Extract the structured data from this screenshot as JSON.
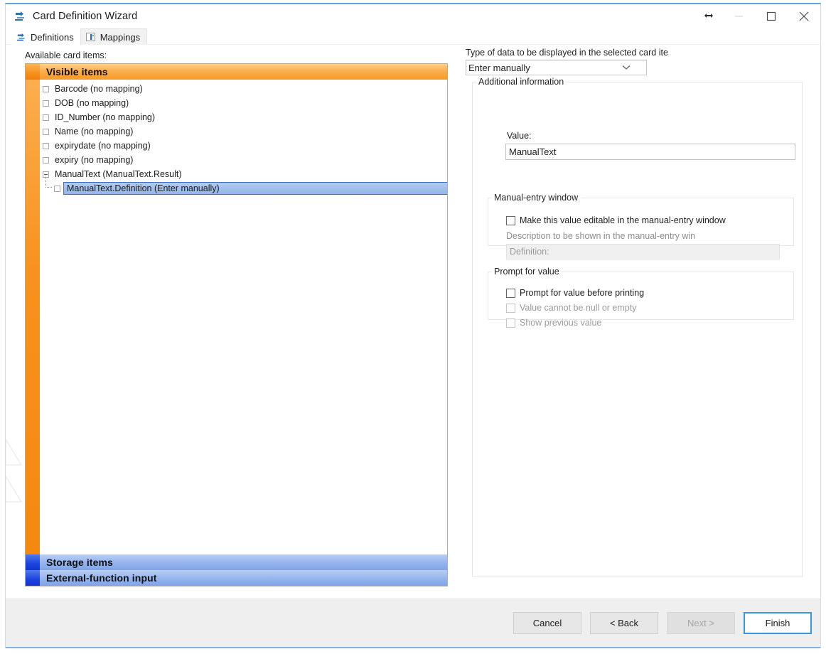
{
  "window": {
    "title": "Card Definition Wizard",
    "icon": "wizard-arrow-icon",
    "controls": {
      "minimize": "—",
      "maximize": "□",
      "close": "✕"
    }
  },
  "tabs": [
    {
      "label": "Definitions",
      "icon": "wizard-arrow-icon",
      "active": false
    },
    {
      "label": "Mappings",
      "icon": "mappings-icon",
      "active": true
    }
  ],
  "left": {
    "label": "Available card items:",
    "groups": [
      {
        "name": "Visible items",
        "color": "#f7921e",
        "accent": "#f79a26"
      },
      {
        "name": "Storage items",
        "color": "#1b42e0",
        "accent": "#9ab8ee"
      },
      {
        "name": "External-function input",
        "color": "#1b42e0",
        "accent": "#9ab8ee"
      }
    ],
    "tree": [
      {
        "label": "Barcode (no mapping)",
        "indent": 0,
        "selected": false,
        "expander": "box"
      },
      {
        "label": "DOB (no mapping)",
        "indent": 0,
        "selected": false,
        "expander": "box"
      },
      {
        "label": "ID_Number (no mapping)",
        "indent": 0,
        "selected": false,
        "expander": "box"
      },
      {
        "label": "Name (no mapping)",
        "indent": 0,
        "selected": false,
        "expander": "box"
      },
      {
        "label": "expirydate (no mapping)",
        "indent": 0,
        "selected": false,
        "expander": "box"
      },
      {
        "label": "expiry (no mapping)",
        "indent": 0,
        "selected": false,
        "expander": "box"
      },
      {
        "label": "ManualText (ManualText.Result)",
        "indent": 0,
        "selected": false,
        "expander": "minus"
      },
      {
        "label": "ManualText.Definition (Enter manually)",
        "indent": 1,
        "selected": true,
        "expander": "box"
      }
    ]
  },
  "right": {
    "type_label": "Type of data to be displayed in the selected card ite",
    "type_value": "Enter manually",
    "additional_legend": "Additional information",
    "value_label": "Value:",
    "value_text": "ManualText",
    "manual_entry": {
      "legend": "Manual-entry window",
      "editable_checkbox": "Make this value editable in the manual-entry window",
      "description_label": "Description to be shown in the manual-entry win",
      "description_value": "Definition:"
    },
    "prompt": {
      "legend": "Prompt for value",
      "options": [
        {
          "label": "Prompt for value before printing",
          "disabled": false,
          "checked": false
        },
        {
          "label": "Value cannot be null or empty",
          "disabled": true,
          "checked": false
        },
        {
          "label": "Show previous value",
          "disabled": true,
          "checked": false
        }
      ]
    }
  },
  "footer": {
    "buttons": [
      {
        "label": "Cancel",
        "state": "normal"
      },
      {
        "label": "< Back",
        "state": "normal"
      },
      {
        "label": "Next >",
        "state": "disabled"
      },
      {
        "label": "Finish",
        "state": "default"
      }
    ]
  }
}
